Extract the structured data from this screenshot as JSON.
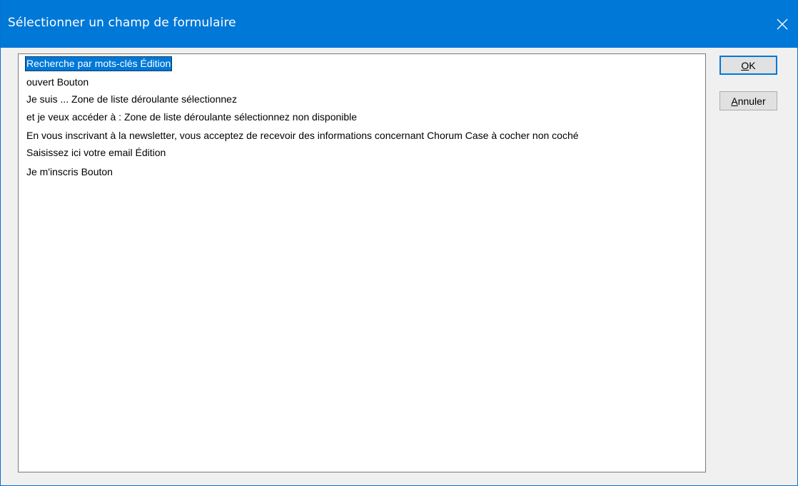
{
  "dialog": {
    "title": "Sélectionner un champ de formulaire",
    "close_icon": "close-icon"
  },
  "fields": [
    {
      "label": "Recherche par mots-clés Édition",
      "selected": true
    },
    {
      "label": "ouvert Bouton",
      "selected": false
    },
    {
      "label": "Je suis ... Zone de liste déroulante sélectionnez",
      "selected": false
    },
    {
      "label": "et je veux accéder à : Zone de liste déroulante sélectionnez  non disponible",
      "selected": false
    },
    {
      "label": "En vous inscrivant à la newsletter, vous acceptez de recevoir des informations concernant Chorum Case à cocher   non coché",
      "selected": false
    },
    {
      "label": "Saisissez ici votre email Édition",
      "selected": false
    },
    {
      "label": "Je m'inscris Bouton",
      "selected": false
    }
  ],
  "buttons": {
    "ok": {
      "accel": "O",
      "rest": "K"
    },
    "cancel": {
      "accel": "A",
      "rest": "nnuler"
    }
  },
  "colors": {
    "titlebar": "#0078d7",
    "selection": "#0078d7",
    "background": "#f0f0f0"
  }
}
